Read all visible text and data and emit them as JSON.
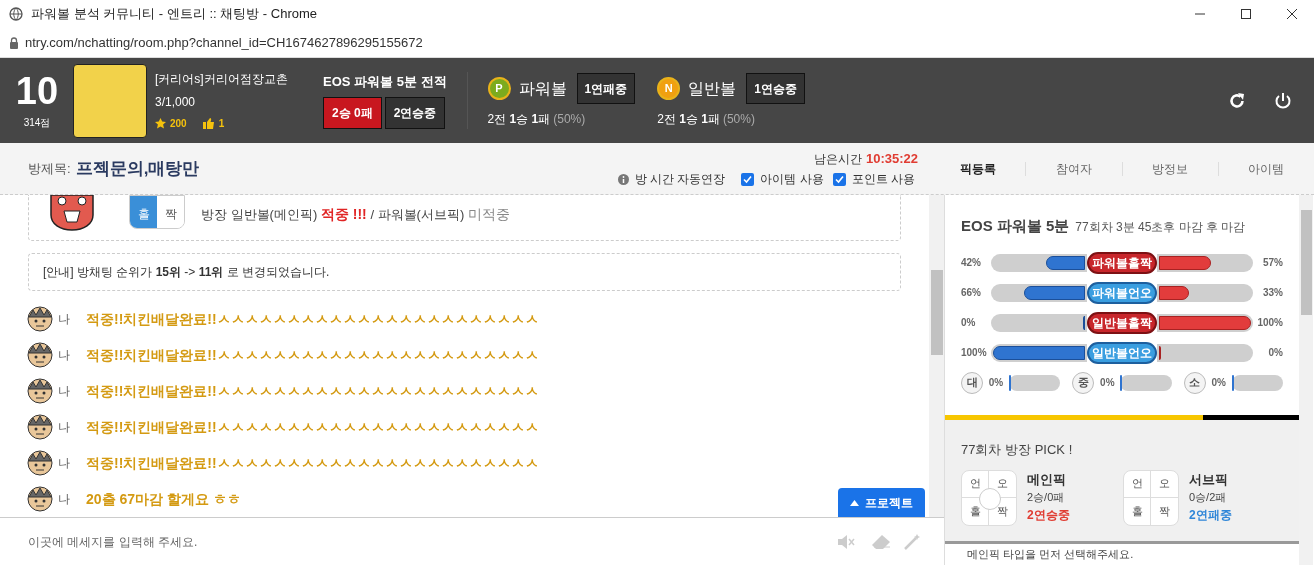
{
  "window": {
    "title": "파워볼 분석 커뮤니티 - 엔트리 :: 채팅방 - Chrome"
  },
  "address_bar": {
    "url": "ntry.com/nchatting/room.php?channel_id=CH1674627896295155672"
  },
  "header": {
    "rank": "10",
    "points": "314점",
    "room_name": "[커리어s]커리어점장교촌",
    "members": "3/1,000",
    "stars": "200",
    "likes": "1",
    "record": {
      "title": "EOS 파워볼 5분 전적",
      "score": "2승 0패",
      "streak": "2연승중"
    },
    "balls": [
      {
        "letter": "P",
        "name": "파워볼",
        "streak": "1연패중",
        "summary": "2전 **1**승 **1**패",
        "rate": "(50%)",
        "color": "#7cab1e"
      },
      {
        "letter": "N",
        "name": "일반볼",
        "streak": "1연승중",
        "summary": "2전 **1**승 **1**패",
        "rate": "(50%)",
        "color": "#f0a010"
      }
    ]
  },
  "room": {
    "label": "방제목:",
    "title": "프젝문의,매탕만",
    "time_label": "남은시간",
    "time": "10:35:22",
    "auto_extend": "방 시간 자동연장",
    "options": [
      {
        "label": "아이템 사용",
        "checked": true
      },
      {
        "label": "포인트 사용",
        "checked": true
      }
    ]
  },
  "side_tabs": [
    {
      "label": "픽등록",
      "selected": true
    },
    {
      "label": "참여자",
      "selected": false
    },
    {
      "label": "방정보",
      "selected": false
    },
    {
      "label": "아이템",
      "selected": false
    }
  ],
  "chat": {
    "result_card": {
      "pick_options": [
        {
          "label": "홀",
          "selected": true
        },
        {
          "label": "짝",
          "selected": false
        }
      ],
      "segments": [
        {
          "text": "방장 일반볼(메인픽) ",
          "kind": "plain"
        },
        {
          "text": "적중 !!!",
          "kind": "hit"
        },
        {
          "text": " / 파워볼(서브픽) ",
          "kind": "plain"
        },
        {
          "text": "미적중",
          "kind": "miss"
        }
      ]
    },
    "notice": "[안내] 방채팅 순위가 **15위** -> **11위** 로 변경되었습니다.",
    "messages": [
      {
        "sender": "나",
        "text": "적중!!치킨배달완료!!ㅅㅅㅅㅅㅅㅅㅅㅅㅅㅅㅅㅅㅅㅅㅅㅅㅅㅅㅅㅅㅅㅅㅅ"
      },
      {
        "sender": "나",
        "text": "적중!!치킨배달완료!!ㅅㅅㅅㅅㅅㅅㅅㅅㅅㅅㅅㅅㅅㅅㅅㅅㅅㅅㅅㅅㅅㅅㅅ"
      },
      {
        "sender": "나",
        "text": "적중!!치킨배달완료!!ㅅㅅㅅㅅㅅㅅㅅㅅㅅㅅㅅㅅㅅㅅㅅㅅㅅㅅㅅㅅㅅㅅㅅ"
      },
      {
        "sender": "나",
        "text": "적중!!치킨배달완료!!ㅅㅅㅅㅅㅅㅅㅅㅅㅅㅅㅅㅅㅅㅅㅅㅅㅅㅅㅅㅅㅅㅅㅅ"
      },
      {
        "sender": "나",
        "text": "적중!!치킨배달완료!!ㅅㅅㅅㅅㅅㅅㅅㅅㅅㅅㅅㅅㅅㅅㅅㅅㅅㅅㅅㅅㅅㅅㅅ"
      },
      {
        "sender": "나",
        "text": "20출 67마감 할게요 ㅎㅎ"
      }
    ],
    "project_button": "프로젝트",
    "input": {
      "placeholder": "이곳에 메세지를 입력해 주세요."
    }
  },
  "stats": {
    "title": "EOS 파워볼 5분",
    "subtitle": "77회차 3분 45초후 마감 후 마감",
    "bars": [
      {
        "label": "파워볼홀짝",
        "kind": "red",
        "left": {
          "text": "42%",
          "level": 0.42
        },
        "right": {
          "text": "57%",
          "level": 0.57
        }
      },
      {
        "label": "파워볼언오",
        "kind": "blue",
        "left": {
          "text": "66%",
          "level": 0.66
        },
        "right": {
          "text": "33%",
          "level": 0.33
        }
      },
      {
        "label": "일반볼홀짝",
        "kind": "red",
        "left": {
          "text": "0%",
          "level": 0
        },
        "right": {
          "text": "100%",
          "level": 1
        }
      },
      {
        "label": "일반볼언오",
        "kind": "blue",
        "left": {
          "text": "100%",
          "level": 1
        },
        "right": {
          "text": "0%",
          "level": 0
        }
      }
    ],
    "sizes": [
      {
        "letter": "대",
        "text": "0%",
        "level": 0
      },
      {
        "letter": "중",
        "text": "0%",
        "level": 0
      },
      {
        "letter": "소",
        "text": "0%",
        "level": 0
      }
    ],
    "countdown": {
      "level": 0.73
    }
  },
  "pick": {
    "title": "77회차 방장 PICK !",
    "cards": [
      {
        "name": "메인픽",
        "record": "2승/0패",
        "streak": "2연승중",
        "color": "#e03c32",
        "marker": true,
        "cells": [
          "언",
          "오",
          "홀",
          "짝"
        ]
      },
      {
        "name": "서브픽",
        "record": "0승/2패",
        "streak": "2연패중",
        "color": "#2f86d8",
        "marker": false,
        "cells": [
          "언",
          "오",
          "홀",
          "짝"
        ]
      }
    ],
    "hint": "메인픽 타입을 먼저 선택해주세요."
  }
}
